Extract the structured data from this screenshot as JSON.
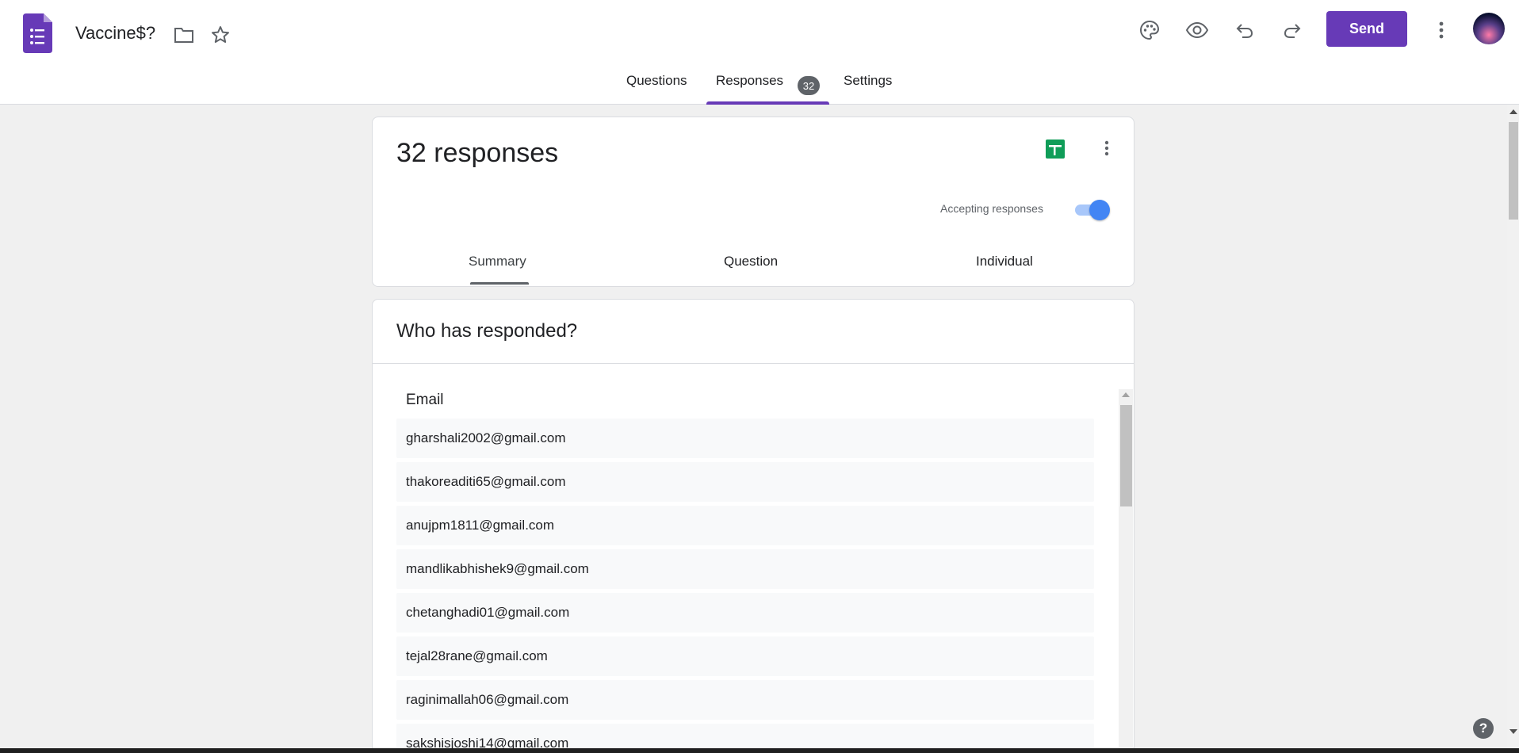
{
  "header": {
    "doc_title": "Vaccine$?",
    "send_label": "Send",
    "tabs": [
      {
        "label": "Questions"
      },
      {
        "label": "Responses",
        "badge": "32"
      },
      {
        "label": "Settings"
      }
    ],
    "active_tab": "Responses"
  },
  "summary_card": {
    "title": "32 responses",
    "accepting_label": "Accepting responses",
    "accepting": true,
    "subtabs": [
      {
        "label": "Summary"
      },
      {
        "label": "Question"
      },
      {
        "label": "Individual"
      }
    ],
    "active_subtab": "Summary"
  },
  "responders_card": {
    "title": "Who has responded?",
    "column_header": "Email",
    "emails": [
      "gharshali2002@gmail.com",
      "thakoreaditi65@gmail.com",
      "anujpm1811@gmail.com",
      "mandlikabhishek9@gmail.com",
      "chetanghadi01@gmail.com",
      "tejal28rane@gmail.com",
      "raginimallah06@gmail.com",
      "sakshisjoshi14@gmail.com"
    ]
  },
  "help_label": "?",
  "colors": {
    "brand": "#673ab7",
    "sheets_green": "#0f9d58",
    "toggle_blue": "#4285f4"
  },
  "icons": [
    "forms-logo",
    "folder-icon",
    "star-icon",
    "palette-icon",
    "eye-icon",
    "undo-icon",
    "redo-icon",
    "more-vert-icon",
    "sheets-icon",
    "help-icon"
  ]
}
